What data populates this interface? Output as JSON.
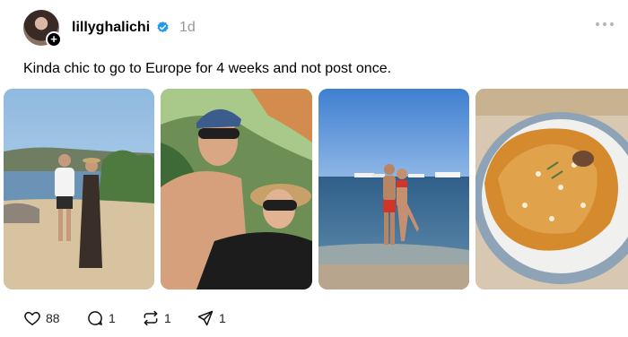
{
  "post": {
    "username": "lillyghalichi",
    "time": "1d",
    "caption": "Kinda chic to go to Europe for 4 weeks and not post once."
  },
  "icons": {
    "verified": "verified-badge-icon",
    "follow": "plus-icon",
    "more": "more-horizontal-icon",
    "like": "heart-icon",
    "reply": "comment-icon",
    "repost": "repost-icon",
    "share": "send-icon"
  },
  "photos": [
    {
      "subject": "couple on beach by coastline"
    },
    {
      "subject": "couple selfie under trees"
    },
    {
      "subject": "couple standing in sea"
    },
    {
      "subject": "plate of pasta with cheese"
    }
  ],
  "actions": {
    "likes": "88",
    "replies": "1",
    "reposts": "1",
    "shares": "1"
  },
  "colors": {
    "verified": "#1d9bf0",
    "muted": "#999999"
  }
}
